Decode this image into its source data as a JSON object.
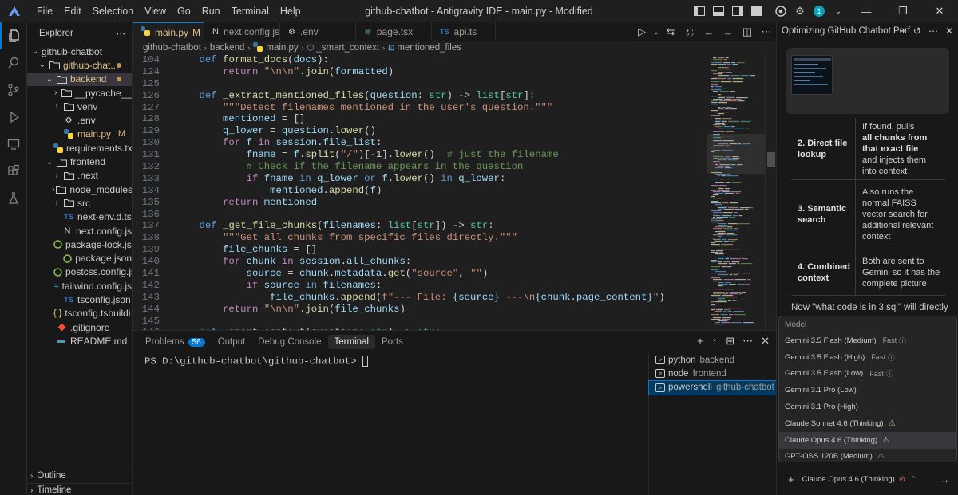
{
  "window": {
    "title": "github-chatbot - Antigravity IDE - main.py - Modified"
  },
  "menu": [
    "File",
    "Edit",
    "Selection",
    "View",
    "Go",
    "Run",
    "Terminal",
    "Help"
  ],
  "explorer": {
    "header": "Explorer",
    "items": [
      {
        "label": "github-chatbot",
        "depth": 0,
        "chev": "⌄",
        "icon": "",
        "color": "#cccccc"
      },
      {
        "label": "github-chat...",
        "depth": 1,
        "chev": "⌄",
        "icon": "folder",
        "color": "#e2c08d",
        "dot": true
      },
      {
        "label": "backend",
        "depth": 2,
        "chev": "⌄",
        "icon": "folder",
        "color": "#e2c08d",
        "dot": true,
        "selected": true
      },
      {
        "label": "__pycache__",
        "depth": 3,
        "chev": "›",
        "icon": "folder",
        "color": "#cccccc"
      },
      {
        "label": "venv",
        "depth": 3,
        "chev": "›",
        "icon": "folder",
        "color": "#cccccc"
      },
      {
        "label": ".env",
        "depth": 3,
        "chev": "",
        "icon": "gear",
        "color": "#cccccc"
      },
      {
        "label": "main.py",
        "depth": 3,
        "chev": "",
        "icon": "python",
        "color": "#e2c08d",
        "badge": "M"
      },
      {
        "label": "requirements.txt",
        "depth": 3,
        "chev": "",
        "icon": "python",
        "color": "#cccccc"
      },
      {
        "label": "frontend",
        "depth": 2,
        "chev": "⌄",
        "icon": "folder",
        "color": "#cccccc"
      },
      {
        "label": ".next",
        "depth": 3,
        "chev": "›",
        "icon": "folder",
        "color": "#cccccc"
      },
      {
        "label": "node_modules",
        "depth": 3,
        "chev": "›",
        "icon": "folder",
        "color": "#cccccc"
      },
      {
        "label": "src",
        "depth": 3,
        "chev": "›",
        "icon": "folder",
        "color": "#cccccc"
      },
      {
        "label": "next-env.d.ts",
        "depth": 3,
        "chev": "",
        "icon": "ts",
        "color": "#cccccc"
      },
      {
        "label": "next.config.js",
        "depth": 3,
        "chev": "",
        "icon": "N",
        "color": "#cccccc"
      },
      {
        "label": "package-lock.js...",
        "depth": 3,
        "chev": "",
        "icon": "pkg",
        "color": "#cccccc"
      },
      {
        "label": "package.json",
        "depth": 3,
        "chev": "",
        "icon": "pkg",
        "color": "#cccccc"
      },
      {
        "label": "postcss.config.js",
        "depth": 3,
        "chev": "",
        "icon": "pkg",
        "color": "#cccccc"
      },
      {
        "label": "tailwind.config.js",
        "depth": 3,
        "chev": "",
        "icon": "tw",
        "color": "#cccccc"
      },
      {
        "label": "tsconfig.json",
        "depth": 3,
        "chev": "",
        "icon": "ts",
        "color": "#cccccc"
      },
      {
        "label": "tsconfig.tsbuildi...",
        "depth": 3,
        "chev": "",
        "icon": "braces",
        "color": "#cccccc"
      },
      {
        "label": ".gitignore",
        "depth": 2,
        "chev": "",
        "icon": "git",
        "color": "#cccccc"
      },
      {
        "label": "README.md",
        "depth": 2,
        "chev": "",
        "icon": "md",
        "color": "#cccccc"
      }
    ],
    "outline": "Outline",
    "timeline": "Timeline"
  },
  "tabs": [
    {
      "label": "main.py",
      "badge": "M",
      "icon": "python",
      "active": true
    },
    {
      "label": "next.config.js",
      "icon": "N"
    },
    {
      "label": ".env",
      "icon": "gear"
    },
    {
      "label": "page.tsx",
      "icon": "react"
    },
    {
      "label": "api.ts",
      "icon": "TS"
    }
  ],
  "breadcrumb": [
    "github-chatbot",
    "backend",
    "main.py",
    "_smart_context",
    "mentioned_files"
  ],
  "code": [
    {
      "n": "104",
      "t": [
        [
          "    ",
          "tx"
        ],
        [
          "def ",
          "kw"
        ],
        [
          "format_docs",
          "fn"
        ],
        [
          "(",
          "tx"
        ],
        [
          "docs",
          "va"
        ],
        [
          "):",
          "tx"
        ]
      ]
    },
    {
      "n": "124",
      "t": [
        [
          "        ",
          "tx"
        ],
        [
          "return ",
          "ct"
        ],
        [
          "\"\\n\\n\"",
          "st"
        ],
        [
          ".",
          "tx"
        ],
        [
          "join",
          "fn"
        ],
        [
          "(",
          "tx"
        ],
        [
          "formatted",
          "va"
        ],
        [
          ")",
          "tx"
        ]
      ]
    },
    {
      "n": "125",
      "t": []
    },
    {
      "n": "126",
      "t": [
        [
          "    ",
          "tx"
        ],
        [
          "def ",
          "kw"
        ],
        [
          "_extract_mentioned_files",
          "fn"
        ],
        [
          "(",
          "tx"
        ],
        [
          "question",
          "va"
        ],
        [
          ": ",
          "tx"
        ],
        [
          "str",
          "ty"
        ],
        [
          ") -> ",
          "tx"
        ],
        [
          "list",
          "ty"
        ],
        [
          "[",
          "tx"
        ],
        [
          "str",
          "ty"
        ],
        [
          "]:",
          "tx"
        ]
      ]
    },
    {
      "n": "127",
      "t": [
        [
          "        ",
          "tx"
        ],
        [
          "\"\"\"Detect filenames mentioned in the user's question.\"\"\"",
          "st"
        ]
      ]
    },
    {
      "n": "128",
      "t": [
        [
          "        ",
          "tx"
        ],
        [
          "mentioned",
          "va"
        ],
        [
          " = []",
          "tx"
        ]
      ]
    },
    {
      "n": "129",
      "t": [
        [
          "        ",
          "tx"
        ],
        [
          "q_lower",
          "va"
        ],
        [
          " = ",
          "tx"
        ],
        [
          "question",
          "va"
        ],
        [
          ".",
          "tx"
        ],
        [
          "lower",
          "fn"
        ],
        [
          "()",
          "tx"
        ]
      ]
    },
    {
      "n": "130",
      "t": [
        [
          "        ",
          "tx"
        ],
        [
          "for ",
          "ct"
        ],
        [
          "f ",
          "va"
        ],
        [
          "in ",
          "ct"
        ],
        [
          "session",
          "va"
        ],
        [
          ".",
          "tx"
        ],
        [
          "file_list",
          "va"
        ],
        [
          ":",
          "tx"
        ]
      ]
    },
    {
      "n": "131",
      "t": [
        [
          "            ",
          "tx"
        ],
        [
          "fname",
          "va"
        ],
        [
          " = ",
          "tx"
        ],
        [
          "f",
          "va"
        ],
        [
          ".",
          "tx"
        ],
        [
          "split",
          "fn"
        ],
        [
          "(",
          "tx"
        ],
        [
          "\"/\"",
          "st"
        ],
        [
          ")[-",
          "tx"
        ],
        [
          "1",
          "tx"
        ],
        [
          "].",
          "tx"
        ],
        [
          "lower",
          "fn"
        ],
        [
          "()  ",
          "tx"
        ],
        [
          "# just the filename",
          "cm"
        ]
      ]
    },
    {
      "n": "132",
      "t": [
        [
          "            ",
          "tx"
        ],
        [
          "# Check if the filename appears in the question",
          "cm"
        ]
      ]
    },
    {
      "n": "133",
      "t": [
        [
          "            ",
          "tx"
        ],
        [
          "if ",
          "ct"
        ],
        [
          "fname ",
          "va"
        ],
        [
          "in ",
          "kw"
        ],
        [
          "q_lower ",
          "va"
        ],
        [
          "or ",
          "kw"
        ],
        [
          "f",
          "va"
        ],
        [
          ".",
          "tx"
        ],
        [
          "lower",
          "fn"
        ],
        [
          "() ",
          "tx"
        ],
        [
          "in ",
          "kw"
        ],
        [
          "q_lower",
          "va"
        ],
        [
          ":",
          "tx"
        ]
      ]
    },
    {
      "n": "134",
      "t": [
        [
          "                ",
          "tx"
        ],
        [
          "mentioned",
          "va"
        ],
        [
          ".",
          "tx"
        ],
        [
          "append",
          "fn"
        ],
        [
          "(",
          "tx"
        ],
        [
          "f",
          "va"
        ],
        [
          ")",
          "tx"
        ]
      ]
    },
    {
      "n": "135",
      "t": [
        [
          "        ",
          "tx"
        ],
        [
          "return ",
          "ct"
        ],
        [
          "mentioned",
          "va"
        ]
      ]
    },
    {
      "n": "136",
      "t": []
    },
    {
      "n": "137",
      "t": [
        [
          "    ",
          "tx"
        ],
        [
          "def ",
          "kw"
        ],
        [
          "_get_file_chunks",
          "fn"
        ],
        [
          "(",
          "tx"
        ],
        [
          "filenames",
          "va"
        ],
        [
          ": ",
          "tx"
        ],
        [
          "list",
          "ty"
        ],
        [
          "[",
          "tx"
        ],
        [
          "str",
          "ty"
        ],
        [
          "]) -> ",
          "tx"
        ],
        [
          "str",
          "ty"
        ],
        [
          ":",
          "tx"
        ]
      ]
    },
    {
      "n": "138",
      "t": [
        [
          "        ",
          "tx"
        ],
        [
          "\"\"\"Get all chunks from specific files directly.\"\"\"",
          "st"
        ]
      ]
    },
    {
      "n": "139",
      "t": [
        [
          "        ",
          "tx"
        ],
        [
          "file_chunks",
          "va"
        ],
        [
          " = []",
          "tx"
        ]
      ]
    },
    {
      "n": "140",
      "t": [
        [
          "        ",
          "tx"
        ],
        [
          "for ",
          "ct"
        ],
        [
          "chunk ",
          "va"
        ],
        [
          "in ",
          "ct"
        ],
        [
          "session",
          "va"
        ],
        [
          ".",
          "tx"
        ],
        [
          "all_chunks",
          "va"
        ],
        [
          ":",
          "tx"
        ]
      ]
    },
    {
      "n": "141",
      "t": [
        [
          "            ",
          "tx"
        ],
        [
          "source",
          "va"
        ],
        [
          " = ",
          "tx"
        ],
        [
          "chunk",
          "va"
        ],
        [
          ".",
          "tx"
        ],
        [
          "metadata",
          "va"
        ],
        [
          ".",
          "tx"
        ],
        [
          "get",
          "fn"
        ],
        [
          "(",
          "tx"
        ],
        [
          "\"source\"",
          "st"
        ],
        [
          ", ",
          "tx"
        ],
        [
          "\"\"",
          "st"
        ],
        [
          ")",
          "tx"
        ]
      ]
    },
    {
      "n": "142",
      "t": [
        [
          "            ",
          "tx"
        ],
        [
          "if ",
          "ct"
        ],
        [
          "source ",
          "va"
        ],
        [
          "in ",
          "kw"
        ],
        [
          "filenames",
          "va"
        ],
        [
          ":",
          "tx"
        ]
      ]
    },
    {
      "n": "143",
      "t": [
        [
          "                ",
          "tx"
        ],
        [
          "file_chunks",
          "va"
        ],
        [
          ".",
          "tx"
        ],
        [
          "append",
          "fn"
        ],
        [
          "(",
          "tx"
        ],
        [
          "f\"--- File: ",
          "st"
        ],
        [
          "{source}",
          "va"
        ],
        [
          " ---\\n",
          "st"
        ],
        [
          "{chunk.page_content}",
          "va"
        ],
        [
          "\"",
          "st"
        ],
        [
          ")",
          "tx"
        ]
      ]
    },
    {
      "n": "144",
      "t": [
        [
          "        ",
          "tx"
        ],
        [
          "return ",
          "ct"
        ],
        [
          "\"\\n\\n\"",
          "st"
        ],
        [
          ".",
          "tx"
        ],
        [
          "join",
          "fn"
        ],
        [
          "(",
          "tx"
        ],
        [
          "file_chunks",
          "va"
        ],
        [
          ")",
          "tx"
        ]
      ]
    },
    {
      "n": "145",
      "t": []
    },
    {
      "n": "146",
      "t": [
        [
          "    ",
          "tx"
        ],
        [
          "def ",
          "kw"
        ],
        [
          "_smart_context",
          "fn"
        ],
        [
          "(",
          "tx"
        ],
        [
          "question",
          "va"
        ],
        [
          ": ",
          "tx"
        ],
        [
          "str",
          "ty"
        ],
        [
          ") -> ",
          "tx"
        ],
        [
          "str",
          "ty"
        ],
        [
          ":",
          "tx"
        ]
      ]
    }
  ],
  "panel": {
    "tabs": [
      {
        "label": "Problems",
        "badge": "56"
      },
      {
        "label": "Output"
      },
      {
        "label": "Debug Console"
      },
      {
        "label": "Terminal",
        "active": true
      },
      {
        "label": "Ports"
      }
    ],
    "prompt": "PS D:\\github-chatbot\\github-chatbot>",
    "terminals": [
      {
        "name": "python",
        "sub": "backend"
      },
      {
        "name": "node",
        "sub": "frontend"
      },
      {
        "name": "powershell",
        "sub": "github-chatbot",
        "selected": true
      }
    ]
  },
  "agent": {
    "title": "Optimizing GitHub Chatbot Perf",
    "steps": [
      {
        "name": "2. Direct file lookup",
        "desc_parts": [
          [
            "If found, pulls ",
            false
          ],
          [
            "all chunks from that exact file",
            true
          ],
          [
            " and injects them into context",
            false
          ]
        ]
      },
      {
        "name": "3. Semantic search",
        "desc_parts": [
          [
            "Also runs the normal FAISS vector search for additional relevant context",
            false
          ]
        ]
      },
      {
        "name": "4. Combined context",
        "desc_parts": [
          [
            "Both are sent to Gemini so it has the complete picture",
            false
          ]
        ]
      }
    ],
    "now_text": "Now \"what code is in 3.sql\" will directly",
    "model_header": "Model",
    "models": [
      {
        "label": "Gemini 3.5 Flash (Medium)",
        "fast": "Fast"
      },
      {
        "label": "Gemini 3.5 Flash (High)",
        "fast": "Fast"
      },
      {
        "label": "Gemini 3.5 Flash (Low)",
        "fast": "Fast"
      },
      {
        "label": "Gemini 3.1 Pro (Low)"
      },
      {
        "label": "Gemini 3.1 Pro (High)"
      },
      {
        "label": "Claude Sonnet 4.6 (Thinking)",
        "warn": true
      },
      {
        "label": "Claude Opus 4.6 (Thinking)",
        "warn": true,
        "selected": true
      },
      {
        "label": "GPT-OSS 120B (Medium)",
        "warn": true
      }
    ],
    "selected_model": "Claude Opus 4.6 (Thinking)"
  },
  "colors": {
    "accent": "#0078d4",
    "modified": "#e2c08d"
  }
}
